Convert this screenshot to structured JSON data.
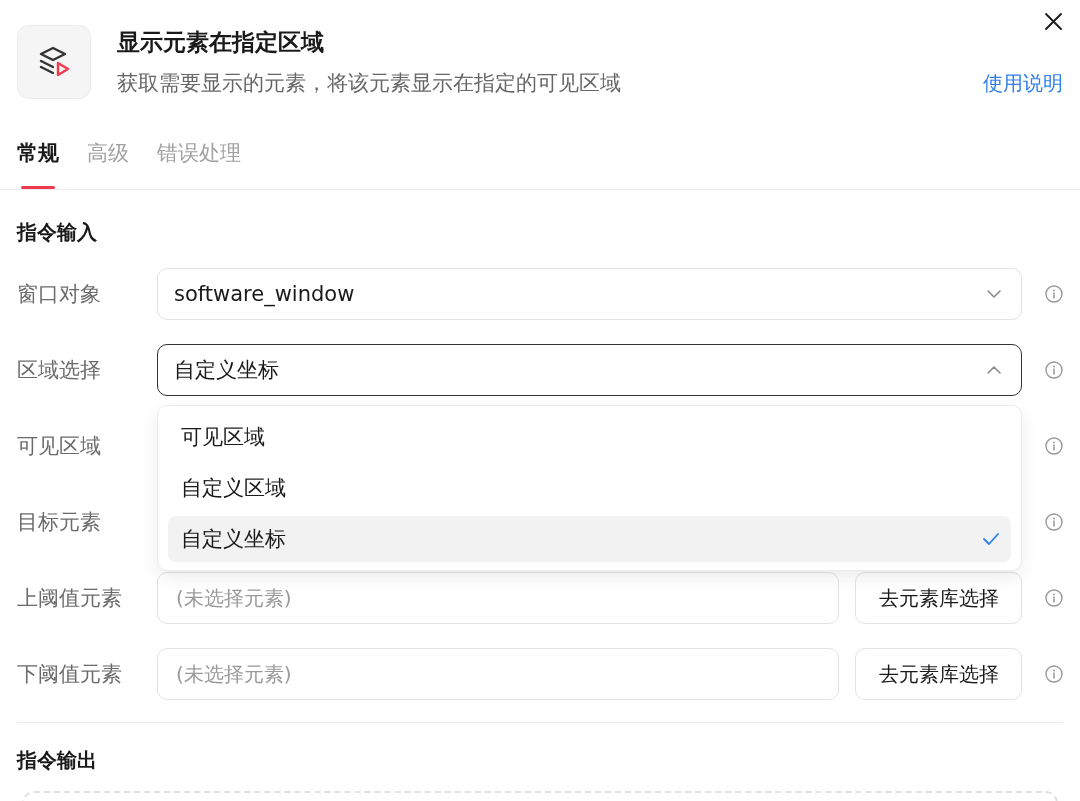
{
  "header": {
    "title": "显示元素在指定区域",
    "description": "获取需要显示的元素，将该元素显示在指定的可见区域",
    "help_link": "使用说明"
  },
  "tabs": [
    {
      "label": "常规",
      "selected": true
    },
    {
      "label": "高级",
      "selected": false
    },
    {
      "label": "错误处理",
      "selected": false
    }
  ],
  "sections": [
    {
      "kind": "form",
      "title": "指令输入",
      "rows": [
        {
          "kind": "select",
          "label": "窗口对象",
          "value": "software_window",
          "expanded": false
        },
        {
          "kind": "select",
          "label": "区域选择",
          "value": "自定义坐标",
          "expanded": true,
          "options": [
            {
              "label": "可见区域",
              "selected": false
            },
            {
              "label": "自定义区域",
              "selected": false
            },
            {
              "label": "自定义坐标",
              "selected": true
            }
          ]
        },
        {
          "kind": "covered",
          "label": "可见区域"
        },
        {
          "kind": "covered",
          "label": "目标元素"
        },
        {
          "kind": "element",
          "label": "上阈值元素",
          "placeholder": "(未选择元素)",
          "button": "去元素库选择"
        },
        {
          "kind": "element",
          "label": "下阈值元素",
          "placeholder": "(未选择元素)",
          "button": "去元素库选择"
        }
      ]
    },
    {
      "kind": "output",
      "title": "指令输出"
    }
  ]
}
